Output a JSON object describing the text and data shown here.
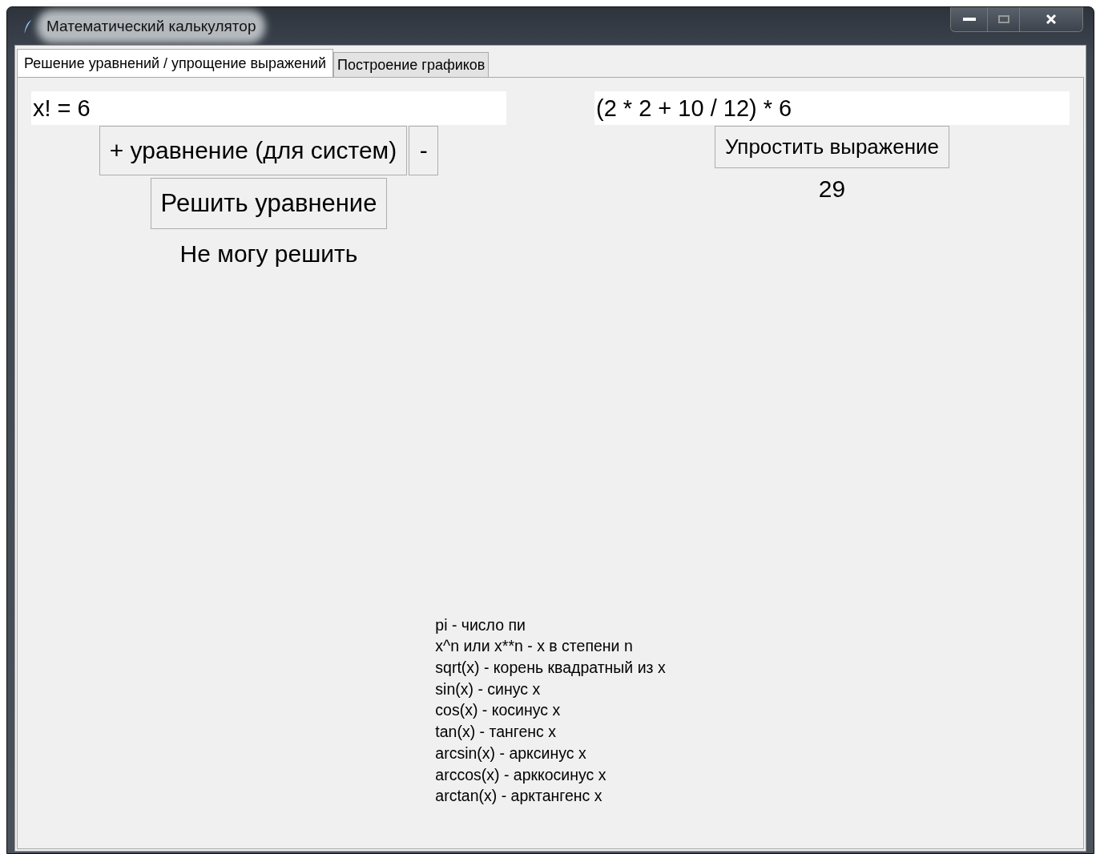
{
  "window": {
    "title": "Математический калькулятор"
  },
  "tabs": [
    {
      "label": "Решение уравнений / упрощение выражений",
      "selected": true
    },
    {
      "label": "Построение графиков",
      "selected": false
    }
  ],
  "equation_panel": {
    "equations": [
      {
        "value": "x! = 6"
      }
    ],
    "add_button": "+ уравнение (для систем)",
    "remove_button": "-",
    "solve_button": "Решить уравнение",
    "result": "Не могу решить"
  },
  "simplify_panel": {
    "expression": "(2 * 2 + 10 / 12) * 6",
    "simplify_button": "Упростить выражение",
    "result": "29"
  },
  "help_lines": [
    "pi - число пи",
    "x^n или x**n - x в степени n",
    "sqrt(x) - корень квадратный из x",
    "sin(x) - синус x",
    "cos(x) - косинус x",
    "tan(x) - тангенс x",
    "arcsin(x) - арксинус x",
    "arccos(x) - арккосинус x",
    "arctan(x) - арктангенс x"
  ]
}
